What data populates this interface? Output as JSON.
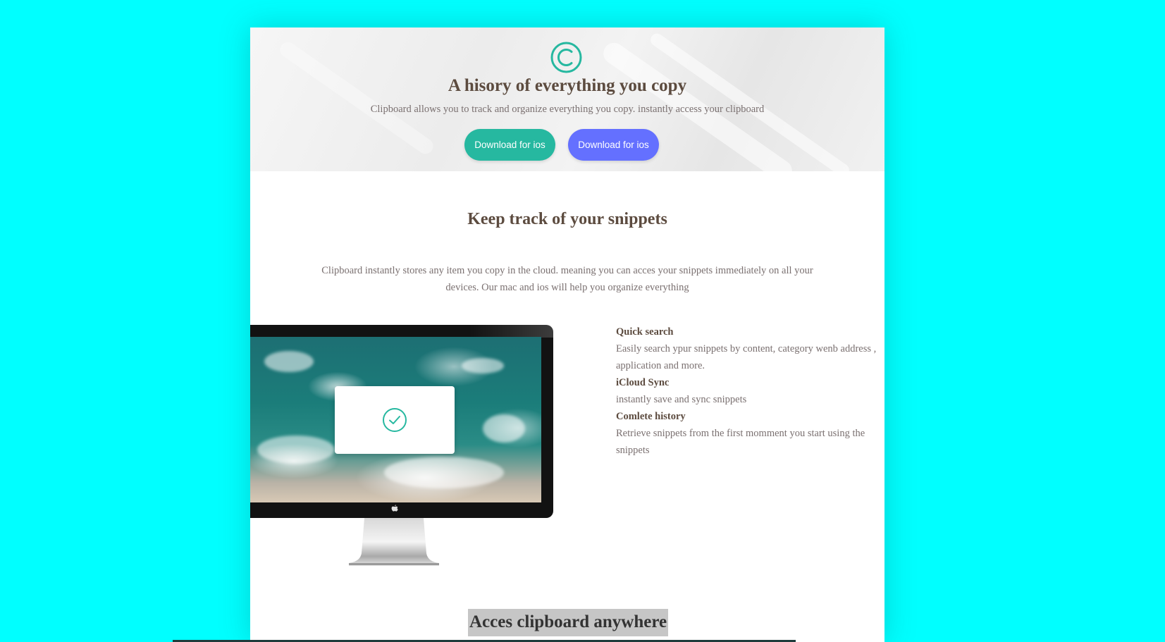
{
  "hero": {
    "title": "A hisory of everything you copy",
    "subtitle": "Clipboard allows you to track and organize everything you copy. instantly access your clipboard",
    "buttons": [
      {
        "label": "Download for ios",
        "color": "#26b8a0"
      },
      {
        "label": "Download for ios",
        "color": "#6470ff"
      }
    ]
  },
  "snippets": {
    "title": "Keep track of your snippets",
    "description": "Clipboard instantly stores any item you copy in the cloud. meaning you can acces your snippets immediately on all your devices. Our mac and ios will help you organize everything"
  },
  "features": [
    {
      "title": "Quick search",
      "text": "Easily search ypur snippets by content, category wenb address , application and more."
    },
    {
      "title": "iCloud Sync",
      "text": "instantly save and sync snippets"
    },
    {
      "title": "Comlete history",
      "text": "Retrieve snippets from the first momment you start using the snippets"
    }
  ],
  "access": {
    "title": "Acces clipboard anywhere"
  },
  "colors": {
    "background": "#00ffff",
    "accent_teal": "#26b8a0",
    "accent_blue": "#6470ff",
    "heading": "#5c4b3f",
    "body_text": "#7a7070"
  },
  "icons": {
    "logo": "copyright-icon",
    "dialog": "check-circle-icon",
    "monitor_brand": "apple-icon"
  }
}
